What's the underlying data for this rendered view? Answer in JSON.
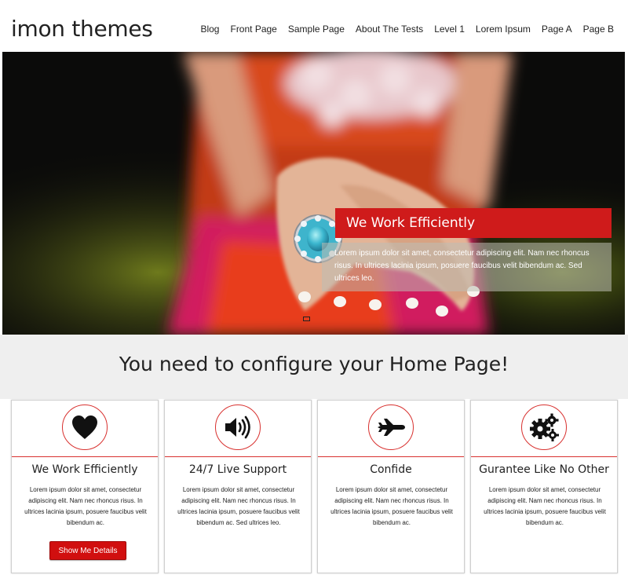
{
  "site": {
    "title": "imon themes"
  },
  "nav": {
    "items": [
      "Blog",
      "Front Page",
      "Sample Page",
      "About The Tests",
      "Level 1",
      "Lorem Ipsum",
      "Page A",
      "Page B"
    ]
  },
  "hero": {
    "caption_title": "We Work Efficiently",
    "caption_text": "Lorem ipsum dolor sit amet, consectetur adipiscing elit. Nam nec rhoncus risus. In ultrices lacinia ipsum, posuere faucibus velit bibendum ac. Sed ultrices leo."
  },
  "config": {
    "title": "You need to configure your Home Page!"
  },
  "colors": {
    "accent": "#d10f0f",
    "band": "#efefef"
  },
  "cards": [
    {
      "icon": "heart-icon",
      "title": "We Work Efficiently",
      "text": "Lorem ipsum dolor sit amet, consectetur adipiscing elit. Nam nec rhoncus risus. In ultrices lacinia ipsum, posuere faucibus velit bibendum ac.",
      "button": "Show Me Details"
    },
    {
      "icon": "speaker-icon",
      "title": "24/7 Live Support",
      "text": "Lorem ipsum dolor sit amet, consectetur adipiscing elit. Nam nec rhoncus risus. In ultrices lacinia ipsum, posuere faucibus velit bibendum ac. Sed ultrices leo."
    },
    {
      "icon": "plane-icon",
      "title": "Confide",
      "text": "Lorem ipsum dolor sit amet, consectetur adipiscing elit. Nam nec rhoncus risus. In ultrices lacinia ipsum, posuere faucibus velit bibendum ac."
    },
    {
      "icon": "gears-icon",
      "title": "Gurantee Like No Other",
      "text": "Lorem ipsum dolor sit amet, consectetur adipiscing elit. Nam nec rhoncus risus. In ultrices lacinia ipsum, posuere faucibus velit bibendum ac."
    }
  ]
}
